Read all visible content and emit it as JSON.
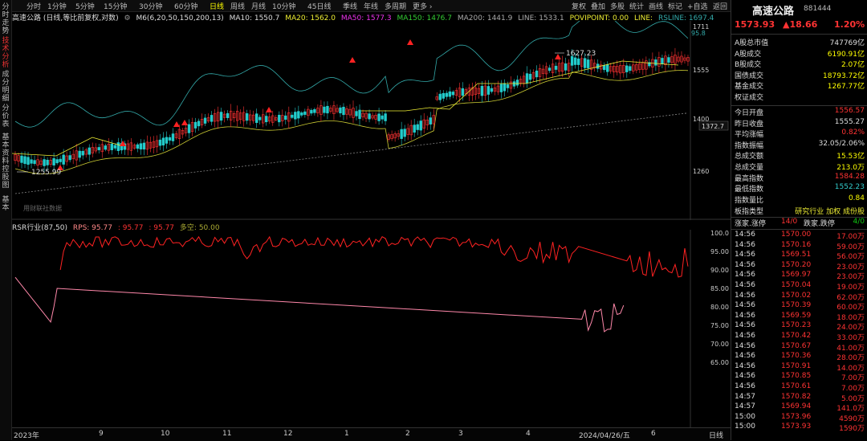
{
  "left_tabs": [
    {
      "label": "分时走势",
      "active": false
    },
    {
      "label": "技术分析",
      "active": true
    },
    {
      "label": "成分明细",
      "active": false
    },
    {
      "label": "分价表",
      "active": false
    },
    {
      "label": "基本资料",
      "active": false
    },
    {
      "label": "控股图",
      "active": false
    },
    {
      "label": "基本",
      "active": false
    }
  ],
  "toolbar": {
    "periods": [
      "分时",
      "1分钟",
      "5分钟",
      "15分钟",
      "30分钟",
      "60分钟",
      "日线",
      "周线",
      "月线",
      "10分钟",
      "45日线",
      "季线",
      "年线",
      "多周期",
      "更多 ›"
    ],
    "active_period": "日线",
    "right": [
      "复权",
      "叠加",
      "多股",
      "统计",
      "画线",
      "标记",
      "+自选",
      "返回"
    ]
  },
  "main_header": {
    "name": "高速公路 (日线,等比前复权,对数)",
    "m6": "M6(6,20,50,150,200,13)",
    "ma10": "MA10: 1550.7",
    "ma20": "MA20: 1562.0",
    "ma50": "MA50: 1577.3",
    "ma150": "MA150: 1476.7",
    "ma200": "MA200: 1441.9",
    "line": "LINE: 1533.1",
    "povipoint": "POVIPOINT: 0.00",
    "line2": "LINE:",
    "rsline": "RSLINE: 1697.4"
  },
  "price_axis": {
    "labels": [
      "1711",
      "1555",
      "1400",
      "1260"
    ],
    "current": "1372.7",
    "rs_label": "95.8"
  },
  "annotations": {
    "high": "1627.23",
    "low": "1255.99",
    "footnote": "用财联社数据"
  },
  "rsr": {
    "title": "RSR行业(87,50)",
    "rps": "RPS: 95.77",
    "v1": ": 95.77",
    "v2": ": 95.77",
    "duo": "多空: 50.00",
    "axis": [
      "100.0",
      "95.00",
      "90.00",
      "85.00",
      "80.00",
      "75.00",
      "70.00",
      "65.00"
    ]
  },
  "x_axis": {
    "labels": [
      "2023年",
      "9",
      "10",
      "11",
      "12",
      "1",
      "2",
      "3",
      "4",
      "2024/04/26/五",
      "6"
    ],
    "right_label": "日线"
  },
  "panel": {
    "title": "高速公路",
    "code": "881444",
    "price": "1573.93",
    "change": "▲18.66",
    "pct": "1.20%",
    "stats1": [
      {
        "l": "A股总市值",
        "r": "747769亿",
        "c": ""
      },
      {
        "l": "A股成交",
        "r": "6190.91亿",
        "c": "yel"
      },
      {
        "l": "B股成交",
        "r": "2.07亿",
        "c": "yel"
      },
      {
        "l": "国债成交",
        "r": "18793.72亿",
        "c": "yel"
      },
      {
        "l": "基金成交",
        "r": "1267.77亿",
        "c": "yel"
      },
      {
        "l": "权证成交",
        "r": "",
        "c": ""
      }
    ],
    "stats2": [
      {
        "l": "今日开盘",
        "r": "1556.57",
        "c": "red"
      },
      {
        "l": "昨日收盘",
        "r": "1555.27",
        "c": ""
      },
      {
        "l": "平均涨幅",
        "r": "0.82%",
        "c": "red"
      },
      {
        "l": "指数振幅",
        "r": "32.05/2.06%",
        "c": ""
      },
      {
        "l": "总成交额",
        "r": "15.53亿",
        "c": "yel"
      },
      {
        "l": "总成交量",
        "r": "213.0万",
        "c": "yel"
      },
      {
        "l": "最高指数",
        "r": "1584.28",
        "c": "red"
      },
      {
        "l": "最低指数",
        "r": "1552.23",
        "c": "cyan"
      },
      {
        "l": "指数量比",
        "r": "0.84",
        "c": "yel"
      }
    ],
    "board_type_label": "板指类型",
    "board_type_value": "研究行业 加权 成份股",
    "updown": {
      "up_label": "涨家.涨停",
      "up_value": "14/0",
      "down_label": "跌家.跌停",
      "down_value": "4/0"
    },
    "ticks": [
      {
        "t": "14:56",
        "p": "1570.00",
        "v": "17.00万"
      },
      {
        "t": "14:56",
        "p": "1570.16",
        "v": "59.00万"
      },
      {
        "t": "14:56",
        "p": "1569.51",
        "v": "56.00万"
      },
      {
        "t": "14:56",
        "p": "1570.20",
        "v": "23.00万"
      },
      {
        "t": "14:56",
        "p": "1569.97",
        "v": "23.00万"
      },
      {
        "t": "14:56",
        "p": "1570.04",
        "v": "19.00万"
      },
      {
        "t": "14:56",
        "p": "1570.02",
        "v": "62.00万"
      },
      {
        "t": "14:56",
        "p": "1570.39",
        "v": "60.00万"
      },
      {
        "t": "14:56",
        "p": "1569.59",
        "v": "18.00万"
      },
      {
        "t": "14:56",
        "p": "1570.23",
        "v": "24.00万"
      },
      {
        "t": "14:56",
        "p": "1570.42",
        "v": "33.00万"
      },
      {
        "t": "14:56",
        "p": "1570.67",
        "v": "41.00万"
      },
      {
        "t": "14:56",
        "p": "1570.36",
        "v": "28.00万"
      },
      {
        "t": "14:56",
        "p": "1570.91",
        "v": "14.00万"
      },
      {
        "t": "14:56",
        "p": "1570.85",
        "v": "7.00万"
      },
      {
        "t": "14:56",
        "p": "1570.61",
        "v": "7.00万"
      },
      {
        "t": "14:57",
        "p": "1570.82",
        "v": "5.00万"
      },
      {
        "t": "14:57",
        "p": "1569.94",
        "v": "141.0万"
      },
      {
        "t": "15:00",
        "p": "1573.96",
        "v": "4590万"
      },
      {
        "t": "15:00",
        "p": "1573.93",
        "v": "1590万"
      }
    ]
  },
  "colors": {
    "up": "#ff3333",
    "down": "#22cccc",
    "ma_yellow": "#cccc33",
    "rs_line": "#33aaaa",
    "rsr_line": "#ff2222",
    "rsr_low": "#ff88aa"
  }
}
